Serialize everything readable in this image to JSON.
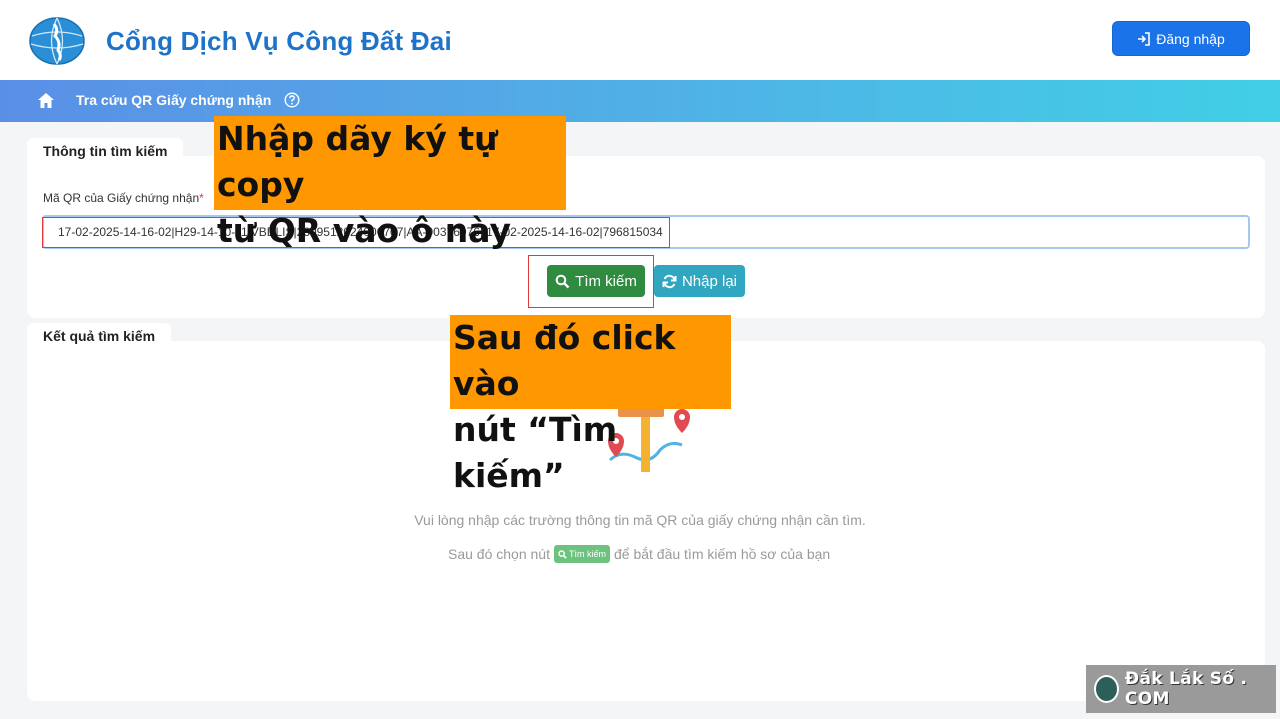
{
  "header": {
    "title": "Cổng Dịch Vụ Công Đất Đai",
    "login_label": "Đăng nhập"
  },
  "nav": {
    "label": "Tra cứu QR Giấy chứng nhận"
  },
  "search_section": {
    "title": "Thông tin tìm kiếm",
    "field_label": "Mã QR của Giấy chứng nhận",
    "required_mark": "*",
    "field_value": "17-02-2025-14-16-02|H29-14-10-11|VBDLIS|2609512024000707|AA-00376076||17-02-2025-14-16-02|796815034",
    "search_button": "Tìm kiếm",
    "reset_button": "Nhập lại"
  },
  "results_section": {
    "title": "Kết quả tìm kiếm",
    "empty_line1": "Vui lòng nhập các trường thông tin mã QR của giấy chứng nhận cần tìm.",
    "empty_line2_prefix": "Sau đó chọn nút",
    "empty_line2_button": "Tìm kiếm",
    "empty_line2_suffix": "để bắt đầu tìm kiếm hồ sơ của bạn"
  },
  "annotations": {
    "callout1_line1": "Nhập dãy ký tự copy",
    "callout1_line2": "từ QR vào ô này",
    "callout2_line1": "Sau đó click vào",
    "callout2_line2": "nút “Tìm kiếm”"
  },
  "watermark": {
    "text": "Đắk Lắk Số . COM"
  },
  "colors": {
    "brand_blue": "#1e73c8",
    "search_green": "#2e8b40",
    "reset_teal": "#31a6c0",
    "callout_orange": "#ff9800",
    "highlight_red": "#e03a3a"
  }
}
